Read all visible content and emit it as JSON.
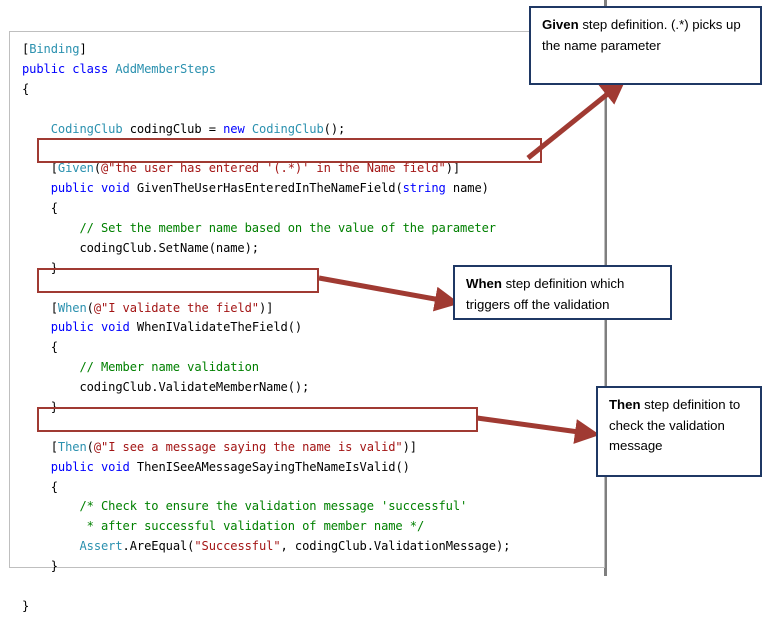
{
  "code_panel": {
    "language": "csharp",
    "lines": [
      {
        "segments": [
          {
            "text": "[",
            "cls": "p"
          },
          {
            "text": "Binding",
            "cls": "t"
          },
          {
            "text": "]",
            "cls": "p"
          }
        ]
      },
      {
        "segments": [
          {
            "text": "public class ",
            "cls": "k"
          },
          {
            "text": "AddMemberSteps",
            "cls": "t"
          }
        ]
      },
      {
        "segments": [
          {
            "text": "{",
            "cls": "p"
          }
        ]
      },
      {
        "segments": []
      },
      {
        "segments": [
          {
            "text": "    ",
            "cls": "p"
          },
          {
            "text": "CodingClub",
            "cls": "t"
          },
          {
            "text": " codingClub = ",
            "cls": "p"
          },
          {
            "text": "new ",
            "cls": "k"
          },
          {
            "text": "CodingClub",
            "cls": "t"
          },
          {
            "text": "();",
            "cls": "p"
          }
        ]
      },
      {
        "segments": []
      },
      {
        "segments": [
          {
            "text": "    [",
            "cls": "p"
          },
          {
            "text": "Given",
            "cls": "t"
          },
          {
            "text": "(",
            "cls": "p"
          },
          {
            "text": "@\"the user has entered '(.*)' in the Name field\"",
            "cls": "s"
          },
          {
            "text": ")]",
            "cls": "p"
          }
        ]
      },
      {
        "segments": [
          {
            "text": "    ",
            "cls": "p"
          },
          {
            "text": "public void ",
            "cls": "k"
          },
          {
            "text": "GivenTheUserHasEnteredInTheNameField(",
            "cls": "p"
          },
          {
            "text": "string",
            "cls": "k"
          },
          {
            "text": " name)",
            "cls": "p"
          }
        ]
      },
      {
        "segments": [
          {
            "text": "    {",
            "cls": "p"
          }
        ]
      },
      {
        "segments": [
          {
            "text": "        ",
            "cls": "p"
          },
          {
            "text": "// Set the member name based on the value of the parameter",
            "cls": "c"
          }
        ]
      },
      {
        "segments": [
          {
            "text": "        codingClub.SetName(name);",
            "cls": "p"
          }
        ]
      },
      {
        "segments": [
          {
            "text": "    }",
            "cls": "p"
          }
        ]
      },
      {
        "segments": []
      },
      {
        "segments": [
          {
            "text": "    [",
            "cls": "p"
          },
          {
            "text": "When",
            "cls": "t"
          },
          {
            "text": "(",
            "cls": "p"
          },
          {
            "text": "@\"I validate the field\"",
            "cls": "s"
          },
          {
            "text": ")]",
            "cls": "p"
          }
        ]
      },
      {
        "segments": [
          {
            "text": "    ",
            "cls": "p"
          },
          {
            "text": "public void ",
            "cls": "k"
          },
          {
            "text": "WhenIValidateTheField()",
            "cls": "p"
          }
        ]
      },
      {
        "segments": [
          {
            "text": "    {",
            "cls": "p"
          }
        ]
      },
      {
        "segments": [
          {
            "text": "        ",
            "cls": "p"
          },
          {
            "text": "// Member name validation",
            "cls": "c"
          }
        ]
      },
      {
        "segments": [
          {
            "text": "        codingClub.ValidateMemberName();",
            "cls": "p"
          }
        ]
      },
      {
        "segments": [
          {
            "text": "    }",
            "cls": "p"
          }
        ]
      },
      {
        "segments": []
      },
      {
        "segments": [
          {
            "text": "    [",
            "cls": "p"
          },
          {
            "text": "Then",
            "cls": "t"
          },
          {
            "text": "(",
            "cls": "p"
          },
          {
            "text": "@\"I see a message saying the name is valid\"",
            "cls": "s"
          },
          {
            "text": ")]",
            "cls": "p"
          }
        ]
      },
      {
        "segments": [
          {
            "text": "    ",
            "cls": "p"
          },
          {
            "text": "public void ",
            "cls": "k"
          },
          {
            "text": "ThenISeeAMessageSayingTheNameIsValid()",
            "cls": "p"
          }
        ]
      },
      {
        "segments": [
          {
            "text": "    {",
            "cls": "p"
          }
        ]
      },
      {
        "segments": [
          {
            "text": "        ",
            "cls": "p"
          },
          {
            "text": "/* Check to ensure the validation message 'successful'",
            "cls": "c"
          }
        ]
      },
      {
        "segments": [
          {
            "text": "         ",
            "cls": "p"
          },
          {
            "text": "* after successful validation of member name */",
            "cls": "c"
          }
        ]
      },
      {
        "segments": [
          {
            "text": "        ",
            "cls": "p"
          },
          {
            "text": "Assert",
            "cls": "t"
          },
          {
            "text": ".AreEqual(",
            "cls": "p"
          },
          {
            "text": "\"Successful\"",
            "cls": "s"
          },
          {
            "text": ", codingClub.ValidationMessage);",
            "cls": "p"
          }
        ]
      },
      {
        "segments": [
          {
            "text": "    }",
            "cls": "p"
          }
        ]
      },
      {
        "segments": []
      },
      {
        "segments": [
          {
            "text": "}",
            "cls": "p"
          }
        ]
      }
    ]
  },
  "highlights": [
    {
      "id": "highlight-given",
      "target": "given-attribute"
    },
    {
      "id": "highlight-when",
      "target": "when-attribute"
    },
    {
      "id": "highlight-then",
      "target": "then-attribute"
    }
  ],
  "callouts": {
    "given": {
      "keyword": "Given",
      "rest": " step definition. (.*) picks up the name parameter"
    },
    "when": {
      "keyword": "When",
      "rest": " step definition which triggers off the validation"
    },
    "then": {
      "keyword": "Then",
      "rest": " step definition to check the validation message"
    }
  },
  "colors": {
    "keyword": "#0000FF",
    "type": "#2B91AF",
    "string": "#A31515",
    "comment": "#008000",
    "plain": "#000000",
    "highlight_border": "#A03A32",
    "callout_border": "#1F3864",
    "arrow": "#A03A32",
    "divider": "#7F7F7F",
    "panel_border": "#BFBFBF",
    "background": "#FFFFFF"
  }
}
